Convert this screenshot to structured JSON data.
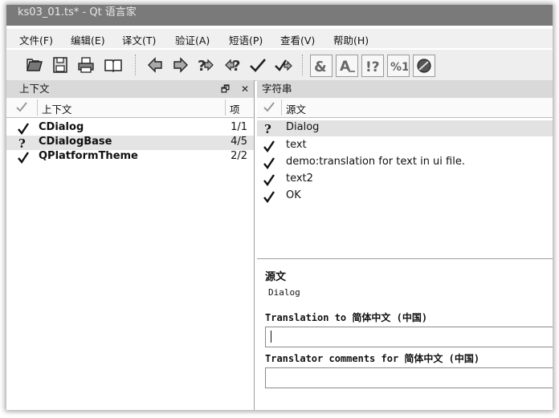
{
  "window": {
    "title": "ks03_01.ts* - Qt 语言家"
  },
  "menu": [
    "文件(F)",
    "编辑(E)",
    "译文(T)",
    "验证(A)",
    "短语(P)",
    "查看(V)",
    "帮助(H)"
  ],
  "context_dock": {
    "title": "上下文",
    "float_glyph": "🗗",
    "close_glyph": "✕",
    "col_context": "上下文",
    "col_items": "项",
    "rows": [
      {
        "name": "CDialog",
        "count": "1/1",
        "status": "done"
      },
      {
        "name": "CDialogBase",
        "count": "4/5",
        "status": "unfinished"
      },
      {
        "name": "QPlatformTheme",
        "count": "2/2",
        "status": "done"
      }
    ]
  },
  "strings_dock": {
    "title": "字符串",
    "col_source": "源文",
    "rows": [
      {
        "text": "Dialog",
        "status": "unfinished"
      },
      {
        "text": "text",
        "status": "done"
      },
      {
        "text": "demo:translation for text in ui file.",
        "status": "done"
      },
      {
        "text": "text2",
        "status": "done"
      },
      {
        "text": "OK",
        "status": "done"
      }
    ]
  },
  "editor": {
    "source_label": "源文",
    "source_text": "Dialog",
    "translation_label": "Translation to 简体中文 (中国)",
    "translation_value": "",
    "comments_label": "Translator comments for 简体中文 (中国)",
    "comments_value": ""
  }
}
